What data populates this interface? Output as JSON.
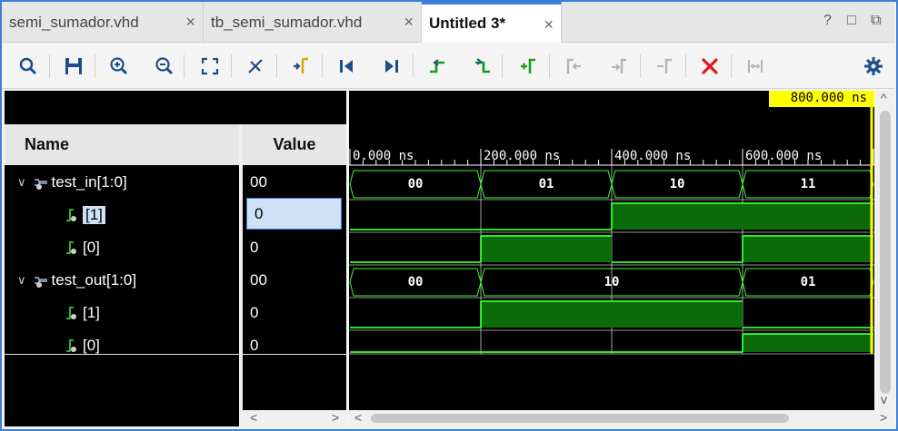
{
  "tabs": [
    {
      "label": "semi_sumador.vhd",
      "active": false
    },
    {
      "label": "tb_semi_sumador.vhd",
      "active": false
    },
    {
      "label": "Untitled 3*",
      "active": true
    }
  ],
  "window_controls": {
    "help": "?",
    "restore": "□",
    "float": "⧉"
  },
  "toolbar": {
    "items": [
      "search-icon",
      "save-icon",
      "zoom-in-icon",
      "zoom-out-icon",
      "zoom-fit-icon",
      "cursor-icon",
      "goto-cursor-icon",
      "goto-start-icon",
      "goto-end-icon",
      "prev-transition-icon",
      "next-transition-icon",
      "add-marker-icon",
      "prev-marker-icon",
      "next-marker-icon",
      "delete-marker-icon",
      "delete-icon",
      "swap-cursor-icon",
      "settings-icon"
    ]
  },
  "columns": {
    "name": "Name",
    "value": "Value"
  },
  "signals": [
    {
      "name": "test_in[1:0]",
      "value": "00",
      "kind": "bus",
      "expanded": true
    },
    {
      "name": "[1]",
      "value": "0",
      "kind": "bit",
      "selected": true
    },
    {
      "name": "[0]",
      "value": "0",
      "kind": "bit"
    },
    {
      "name": "test_out[1:0]",
      "value": "00",
      "kind": "bus",
      "expanded": true
    },
    {
      "name": "[1]",
      "value": "0",
      "kind": "bit"
    },
    {
      "name": "[0]",
      "value": "0",
      "kind": "bit"
    }
  ],
  "wave": {
    "cursor_label": "800.000 ns",
    "ticks": [
      "0.000 ns",
      "200.000 ns",
      "400.000 ns",
      "600.000 ns"
    ],
    "time_range_ns": [
      0,
      800
    ],
    "bus_values": {
      "test_in": [
        "00",
        "01",
        "10",
        "11"
      ],
      "test_out": [
        "00",
        "10",
        "01"
      ]
    },
    "colors": {
      "wave": "#33ff33",
      "fill": "#0b6b0b",
      "cursor": "#ffff00",
      "grid": "#ffffff"
    }
  },
  "arrows": {
    "left": "<",
    "right": ">",
    "up": "^",
    "down": "v"
  }
}
